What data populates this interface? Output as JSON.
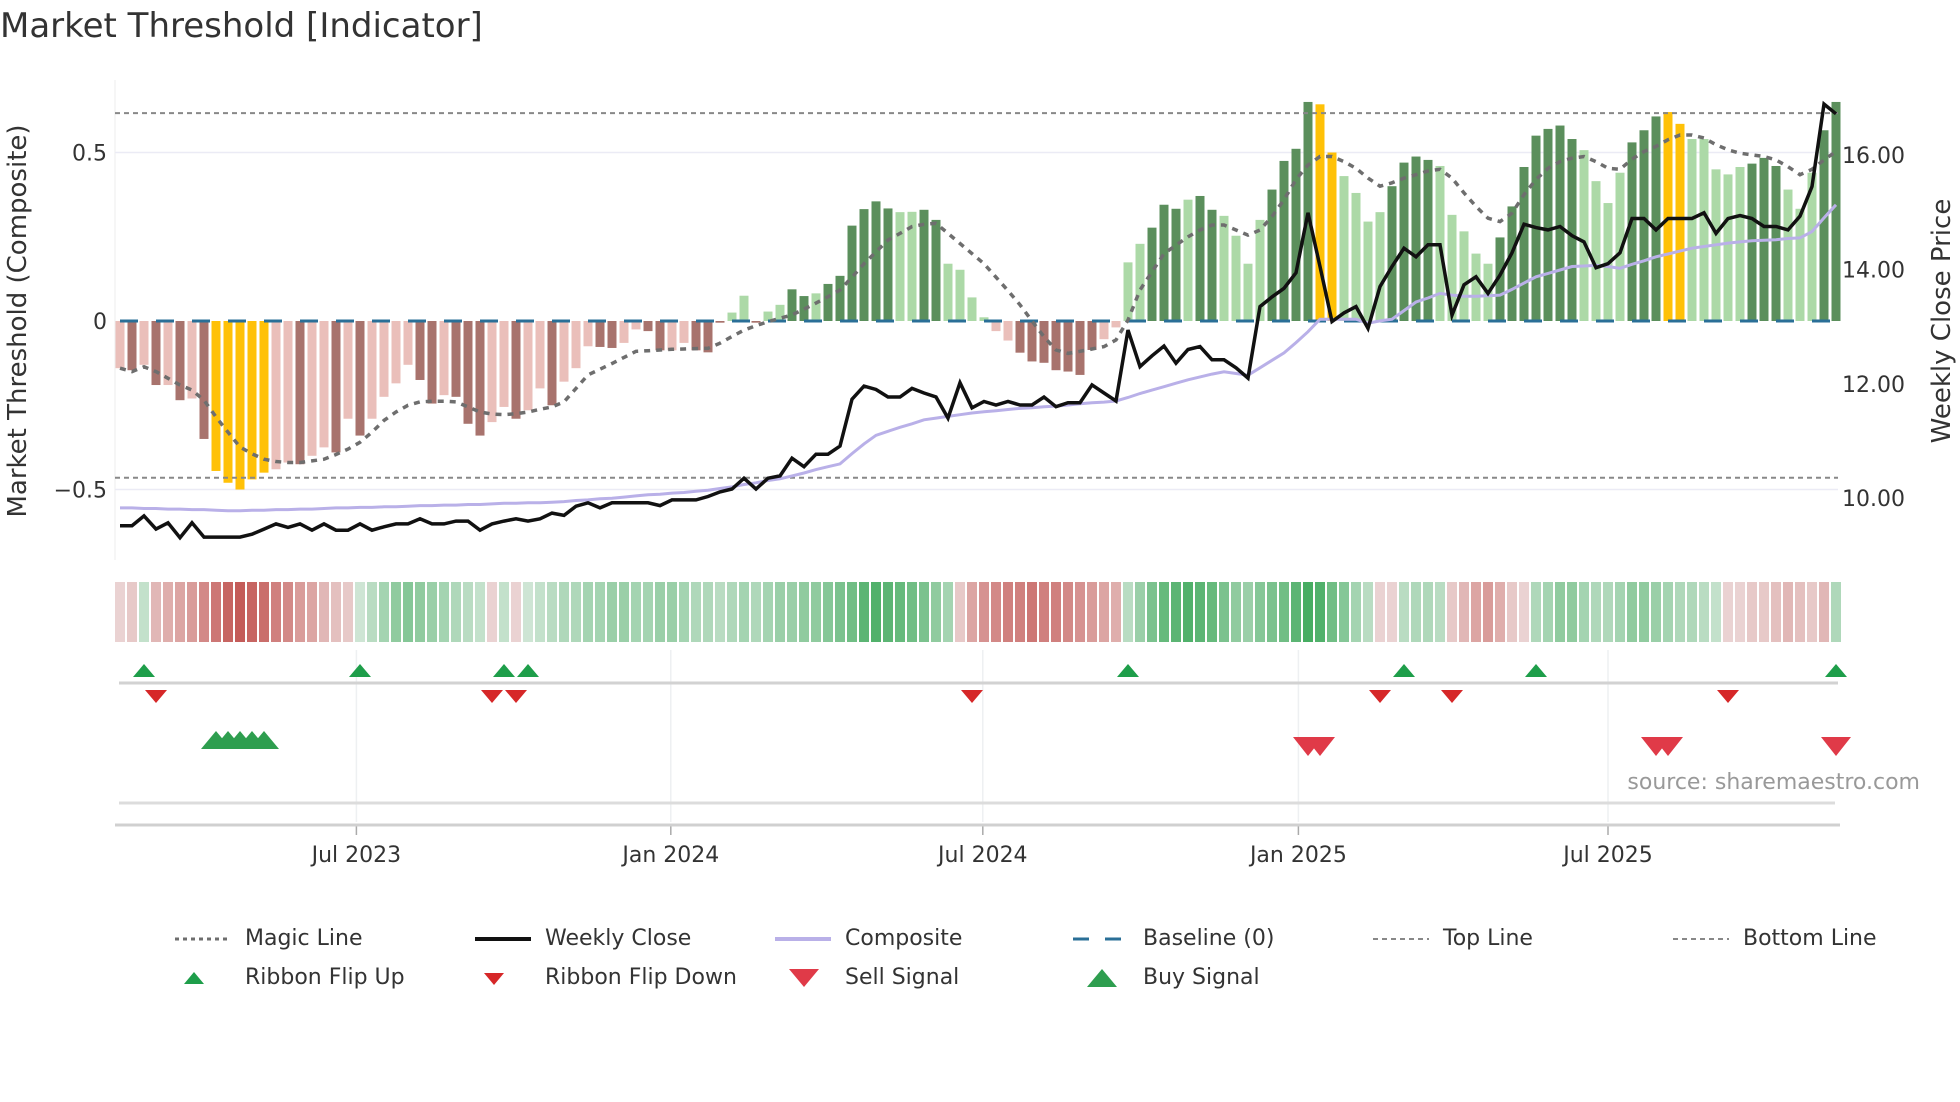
{
  "title": "Market Threshold [Indicator]",
  "source": "source: sharemaestro.com",
  "colors": {
    "neg_dark": "#a8736d",
    "neg_light": "#eabfba",
    "pos_dark": "#5b8f5c",
    "pos_light": "#acd9a7",
    "extreme": "#ffc107",
    "close": "#111111",
    "composite": "#b9b0e8",
    "magic": "#6e6e6e",
    "baseline": "#2a6f97",
    "threshold": "#888888",
    "ribbon_pos": "#3aa757",
    "ribbon_neg": "#c0504d",
    "flip_up": "#1e9e4a",
    "flip_down": "#d62728",
    "buy": "#2e9e4f",
    "sell": "#e03a48"
  },
  "chart_data": {
    "type": "bar",
    "title": "Market Threshold [Indicator]",
    "ylabel_left": "Market Threshold (Composite)",
    "ylabel_right": "Weekly Close Price",
    "ylim_left": [
      -0.72,
      0.72
    ],
    "ylim_right": [
      9.1,
      17.2
    ],
    "left_ticks": [
      {
        "v": 0.5,
        "label": "0.5"
      },
      {
        "v": 0,
        "label": "0"
      },
      {
        "v": -0.5,
        "label": "−0.5"
      }
    ],
    "right_ticks": [
      {
        "v": 16,
        "label": "16.00"
      },
      {
        "v": 14,
        "label": "14.00"
      },
      {
        "v": 12,
        "label": "12.00"
      },
      {
        "v": 10,
        "label": "10.00"
      }
    ],
    "x_ticks": [
      {
        "week": 19.7,
        "label": "Jul 2023"
      },
      {
        "week": 45.9,
        "label": "Jan 2024"
      },
      {
        "week": 71.9,
        "label": "Jul 2024"
      },
      {
        "week": 98.2,
        "label": "Jan 2025"
      },
      {
        "week": 124.0,
        "label": "Jul 2025"
      }
    ],
    "top_line": 0.617,
    "bottom_line": -0.465,
    "baseline": 0,
    "bar_kinds": "ldldldldyyyyylldlldldllllddldddlldlldlllddllddlldddlldllddlddddddllddlllllldddddddlllldddlddllllddddyyllllddddllllldddddddlllldddyyllllldddlllddy",
    "composite_bars": [
      -0.14,
      -0.146,
      -0.13,
      -0.19,
      -0.19,
      -0.235,
      -0.23,
      -0.35,
      -0.445,
      -0.48,
      -0.5,
      -0.47,
      -0.45,
      -0.44,
      -0.42,
      -0.425,
      -0.4,
      -0.375,
      -0.39,
      -0.29,
      -0.34,
      -0.29,
      -0.225,
      -0.185,
      -0.13,
      -0.175,
      -0.245,
      -0.22,
      -0.225,
      -0.305,
      -0.34,
      -0.3,
      -0.255,
      -0.29,
      -0.265,
      -0.2,
      -0.25,
      -0.18,
      -0.14,
      -0.075,
      -0.077,
      -0.08,
      -0.065,
      -0.025,
      -0.03,
      -0.087,
      -0.087,
      -0.065,
      -0.087,
      -0.093,
      -0.005,
      0.025,
      0.075,
      -0.005,
      0.028,
      0.048,
      0.094,
      0.074,
      0.082,
      0.11,
      0.134,
      0.283,
      0.332,
      0.355,
      0.334,
      0.323,
      0.324,
      0.33,
      0.3,
      0.17,
      0.152,
      0.07,
      0.011,
      -0.03,
      -0.058,
      -0.094,
      -0.12,
      -0.124,
      -0.146,
      -0.15,
      -0.16,
      -0.086,
      -0.054,
      -0.019,
      0.174,
      0.229,
      0.277,
      0.345,
      0.333,
      0.36,
      0.371,
      0.33,
      0.312,
      0.253,
      0.17,
      0.3,
      0.39,
      0.475,
      0.511,
      0.65,
      0.643,
      0.5,
      0.43,
      0.38,
      0.295,
      0.323,
      0.4,
      0.47,
      0.488,
      0.478,
      0.46,
      0.315,
      0.266,
      0.2,
      0.17,
      0.248,
      0.34,
      0.457,
      0.55,
      0.57,
      0.58,
      0.54,
      0.507,
      0.415,
      0.35,
      0.44,
      0.53,
      0.566,
      0.607,
      0.62,
      0.585,
      0.54,
      0.54,
      0.45,
      0.435,
      0.457,
      0.467,
      0.484,
      0.46,
      0.39,
      0.333,
      0.44,
      0.566,
      0.65
    ],
    "magic_line": [
      -0.14,
      -0.15,
      -0.136,
      -0.15,
      -0.17,
      -0.19,
      -0.205,
      -0.235,
      -0.285,
      -0.33,
      -0.374,
      -0.394,
      -0.41,
      -0.417,
      -0.42,
      -0.42,
      -0.415,
      -0.41,
      -0.396,
      -0.38,
      -0.36,
      -0.33,
      -0.295,
      -0.27,
      -0.25,
      -0.24,
      -0.238,
      -0.238,
      -0.24,
      -0.255,
      -0.27,
      -0.276,
      -0.278,
      -0.275,
      -0.27,
      -0.262,
      -0.255,
      -0.24,
      -0.2,
      -0.16,
      -0.143,
      -0.126,
      -0.108,
      -0.09,
      -0.088,
      -0.086,
      -0.084,
      -0.083,
      -0.082,
      -0.081,
      -0.066,
      -0.046,
      -0.027,
      -0.014,
      -0.002,
      0.008,
      0.018,
      0.035,
      0.053,
      0.072,
      0.092,
      0.13,
      0.17,
      0.205,
      0.24,
      0.26,
      0.28,
      0.287,
      0.29,
      0.26,
      0.23,
      0.2,
      0.17,
      0.13,
      0.09,
      0.048,
      0,
      -0.047,
      -0.086,
      -0.096,
      -0.09,
      -0.083,
      -0.076,
      -0.056,
      0.003,
      0.092,
      0.146,
      0.2,
      0.225,
      0.25,
      0.27,
      0.285,
      0.285,
      0.27,
      0.255,
      0.27,
      0.31,
      0.36,
      0.42,
      0.463,
      0.488,
      0.488,
      0.473,
      0.453,
      0.424,
      0.4,
      0.41,
      0.424,
      0.434,
      0.445,
      0.45,
      0.424,
      0.38,
      0.34,
      0.305,
      0.295,
      0.32,
      0.375,
      0.42,
      0.453,
      0.473,
      0.483,
      0.488,
      0.473,
      0.453,
      0.45,
      0.48,
      0.503,
      0.518,
      0.538,
      0.552,
      0.552,
      0.543,
      0.523,
      0.508,
      0.498,
      0.493,
      0.488,
      0.478,
      0.458,
      0.434,
      0.45,
      0.478,
      0.503
    ],
    "weekly_close": [
      9.52,
      9.52,
      9.69,
      9.46,
      9.57,
      9.31,
      9.57,
      9.32,
      9.32,
      9.32,
      9.32,
      9.37,
      9.46,
      9.55,
      9.49,
      9.55,
      9.44,
      9.55,
      9.44,
      9.44,
      9.55,
      9.44,
      9.5,
      9.55,
      9.55,
      9.64,
      9.55,
      9.55,
      9.6,
      9.6,
      9.44,
      9.55,
      9.6,
      9.64,
      9.6,
      9.64,
      9.74,
      9.7,
      9.86,
      9.92,
      9.83,
      9.92,
      9.92,
      9.92,
      9.92,
      9.87,
      9.97,
      9.97,
      9.97,
      10.03,
      10.11,
      10.16,
      10.35,
      10.16,
      10.35,
      10.39,
      10.7,
      10.55,
      10.77,
      10.77,
      10.91,
      11.73,
      11.96,
      11.9,
      11.77,
      11.77,
      11.92,
      11.84,
      11.77,
      11.4,
      12.02,
      11.58,
      11.69,
      11.63,
      11.69,
      11.63,
      11.63,
      11.77,
      11.6,
      11.67,
      11.67,
      11.98,
      11.84,
      11.7,
      12.94,
      12.3,
      12.49,
      12.66,
      12.36,
      12.6,
      12.65,
      12.42,
      12.42,
      12.28,
      12.1,
      13.35,
      13.52,
      13.67,
      13.94,
      14.99,
      14.05,
      13.09,
      13.24,
      13.35,
      12.97,
      13.7,
      14.05,
      14.37,
      14.22,
      14.43,
      14.43,
      13.2,
      13.73,
      13.87,
      13.58,
      13.9,
      14.29,
      14.79,
      14.73,
      14.69,
      14.75,
      14.59,
      14.48,
      14.03,
      14.1,
      14.29,
      14.89,
      14.89,
      14.69,
      14.89,
      14.89,
      14.89,
      14.99,
      14.63,
      14.89,
      14.94,
      14.89,
      14.75,
      14.75,
      14.69,
      14.93,
      15.45,
      16.89,
      16.72
    ],
    "composite_line": [
      9.83,
      9.83,
      9.82,
      9.82,
      9.81,
      9.81,
      9.8,
      9.8,
      9.79,
      9.78,
      9.78,
      9.79,
      9.79,
      9.8,
      9.8,
      9.81,
      9.81,
      9.82,
      9.83,
      9.83,
      9.84,
      9.84,
      9.85,
      9.85,
      9.86,
      9.87,
      9.87,
      9.88,
      9.88,
      9.89,
      9.89,
      9.9,
      9.91,
      9.91,
      9.92,
      9.92,
      9.93,
      9.94,
      9.96,
      9.97,
      9.99,
      10.0,
      10.02,
      10.04,
      10.06,
      10.07,
      10.09,
      10.1,
      10.12,
      10.14,
      10.17,
      10.2,
      10.24,
      10.27,
      10.31,
      10.34,
      10.39,
      10.44,
      10.5,
      10.55,
      10.6,
      10.78,
      10.95,
      11.1,
      11.17,
      11.24,
      11.3,
      11.37,
      11.4,
      11.43,
      11.46,
      11.49,
      11.51,
      11.53,
      11.55,
      11.57,
      11.58,
      11.6,
      11.61,
      11.63,
      11.65,
      11.67,
      11.68,
      11.7,
      11.76,
      11.83,
      11.89,
      11.95,
      12.01,
      12.07,
      12.12,
      12.17,
      12.21,
      12.18,
      12.15,
      12.28,
      12.41,
      12.54,
      12.72,
      12.91,
      13.13,
      13.13,
      13.13,
      13.13,
      13.06,
      13.1,
      13.13,
      13.28,
      13.43,
      13.5,
      13.58,
      13.55,
      13.53,
      13.53,
      13.54,
      13.55,
      13.65,
      13.76,
      13.87,
      13.93,
      13.99,
      14.05,
      14.06,
      14.07,
      14.05,
      14.02,
      14.09,
      14.15,
      14.22,
      14.27,
      14.32,
      14.37,
      14.4,
      14.43,
      14.46,
      14.48,
      14.5,
      14.51,
      14.52,
      14.54,
      14.55,
      14.66,
      14.9,
      15.13
    ],
    "ribbon": [
      -0.15,
      -0.2,
      0.2,
      -0.3,
      -0.35,
      -0.4,
      -0.45,
      -0.55,
      -0.65,
      -0.75,
      -0.8,
      -0.75,
      -0.7,
      -0.6,
      -0.55,
      -0.45,
      -0.4,
      -0.3,
      -0.25,
      -0.2,
      0.15,
      0.25,
      0.35,
      0.45,
      0.5,
      0.45,
      0.4,
      0.35,
      0.3,
      0.25,
      0.2,
      -0.15,
      0.2,
      -0.15,
      0.15,
      0.2,
      0.25,
      0.3,
      0.3,
      0.35,
      0.35,
      0.4,
      0.4,
      0.35,
      0.35,
      0.4,
      0.4,
      0.35,
      0.3,
      0.3,
      0.25,
      0.3,
      0.35,
      0.3,
      0.35,
      0.4,
      0.4,
      0.45,
      0.45,
      0.5,
      0.55,
      0.6,
      0.7,
      0.75,
      0.7,
      0.65,
      0.6,
      0.55,
      0.45,
      0.35,
      -0.2,
      -0.4,
      -0.5,
      -0.55,
      -0.6,
      -0.6,
      -0.65,
      -0.6,
      -0.6,
      -0.55,
      -0.5,
      -0.45,
      -0.4,
      -0.35,
      0.25,
      0.4,
      0.55,
      0.65,
      0.7,
      0.75,
      0.7,
      0.65,
      0.55,
      0.45,
      0.4,
      0.5,
      0.55,
      0.6,
      0.7,
      0.8,
      0.75,
      0.6,
      0.5,
      0.35,
      0.25,
      -0.15,
      -0.15,
      0.25,
      0.3,
      0.3,
      0.25,
      -0.2,
      -0.3,
      -0.4,
      -0.45,
      -0.35,
      -0.2,
      -0.15,
      0.3,
      0.35,
      0.45,
      0.45,
      0.35,
      0.3,
      0.3,
      0.35,
      0.45,
      0.45,
      0.4,
      0.35,
      0.3,
      0.3,
      0.25,
      0.2,
      -0.15,
      -0.15,
      -0.2,
      -0.2,
      -0.25,
      -0.3,
      -0.25,
      -0.2,
      -0.3,
      0.3
    ],
    "signals": {
      "ribbon_flip_up": [
        3,
        21,
        33,
        35,
        85,
        108,
        119,
        144
      ],
      "ribbon_flip_down": [
        4,
        32,
        34,
        72,
        106,
        112,
        135
      ],
      "buy": [
        9,
        10,
        11,
        12,
        13
      ],
      "sell": [
        100,
        101,
        129,
        130,
        144
      ]
    },
    "legend_position": "bottom"
  },
  "legend": {
    "magic_line": "Magic Line",
    "weekly_close": "Weekly Close",
    "composite": "Composite",
    "baseline": "Baseline (0)",
    "top_line": "Top Line",
    "bottom_line": "Bottom Line",
    "flip_up": "Ribbon Flip Up",
    "flip_down": "Ribbon Flip Down",
    "sell": "Sell Signal",
    "buy": "Buy Signal"
  }
}
